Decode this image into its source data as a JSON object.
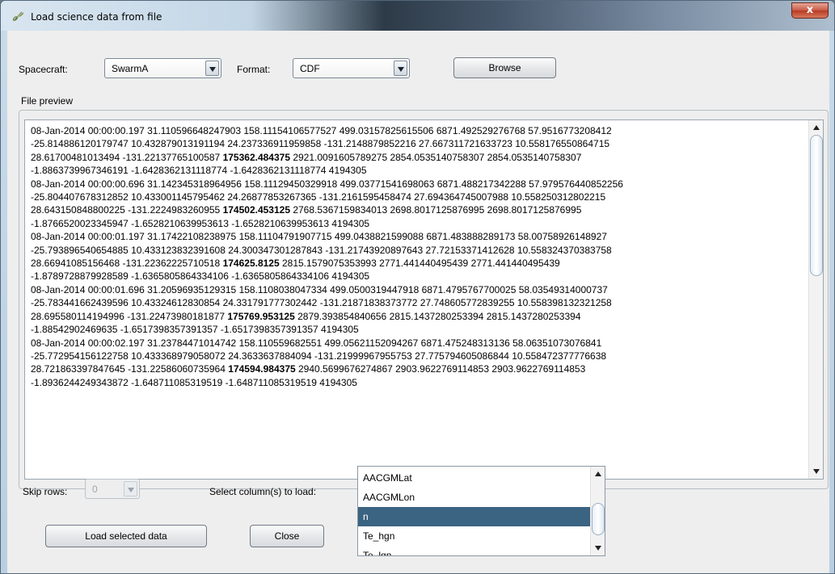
{
  "window": {
    "title": "Load science data from file",
    "close_label": "x"
  },
  "toolbar": {
    "spacecraft_label": "Spacecraft:",
    "spacecraft_value": "SwarmA",
    "format_label": "Format:",
    "format_value": "CDF",
    "browse_label": "Browse"
  },
  "preview": {
    "title": "File preview",
    "lines": [
      "08-Jan-2014 00:00:00.197 31.110596648247903 158.11154106577527 499.03157825615506 6871.492529276768 57.9516773208412",
      "-25.814886120179747 10.432879013191194 24.237336911959858 -131.2148879852216 27.667311721633723 10.558176550864715",
      "28.61700481013494 -131.22137765100587 |175362.484375| 2921.0091605789275 2854.0535140758307 2854.0535140758307",
      "-1.8863739967346191 -1.6428362131118774 -1.6428362131118774 4194305",
      "08-Jan-2014 00:00:00.696 31.142345318964956 158.11129450329918 499.03771541698063 6871.488217342288 57.979576440852256",
      "-25.804407678312852 10.433001145795462 24.26877853267365 -131.2161595458474 27.694364745007988 10.558250312802215",
      "28.643150848800225 -131.2224983260955 |174502.453125| 2768.5367159834013 2698.8017125876995 2698.8017125876995",
      "-1.8766520023345947 -1.6528210639953613 -1.6528210639953613 4194305",
      "08-Jan-2014 00:00:01.197 31.17422108238975 158.11104791907715 499.0438821599088 6871.483888289173 58.00758926148927",
      "-25.793896540654885 10.433123832391608 24.300347301287843 -131.21743920897643 27.72153371412628 10.558324370383758",
      "28.66941085156468 -131.22362225710518 |174625.8125| 2815.1579075353993 2771.441440495439 2771.441440495439",
      "-1.8789728879928589 -1.6365805864334106 -1.6365805864334106 4194305",
      "08-Jan-2014 00:00:01.696 31.20596935129315 158.1108038047334 499.0500319447918 6871.4795767700025 58.03549314000737",
      "-25.783441662439596 10.43324612830854 24.331791777302442 -131.21871838373772 27.748605772839255 10.558398132321258",
      "28.695580114194996 -131.22473980181877 |175769.953125| 2879.393854840656 2815.1437280253394 2815.1437280253394",
      "-1.88542902469635 -1.6517398357391357 -1.6517398357391357 4194305",
      "08-Jan-2014 00:00:02.197 31.23784471014742 158.110559682551 499.05621152094267 6871.475248313136 58.06351073076841",
      "-25.772954156122758 10.433368979058072 24.3633637884094 -131.21999967955753 27.775794605086844 10.558472377776638",
      "28.721863397847645 -131.22586060735964 |174594.984375| 2940.5699676274867 2903.9622769114853 2903.9622769114853",
      "-1.8936244249343872 -1.648711085319519 -1.648711085319519 4194305"
    ]
  },
  "bottom": {
    "skip_rows_label": "Skip rows:",
    "skip_rows_value": "0",
    "select_columns_label": "Select column(s) to load:",
    "columns": [
      "AACGMLat",
      "AACGMLon",
      "n",
      "Te_hgn",
      "Te_lgn"
    ],
    "selected_column": "n",
    "load_button": "Load selected data",
    "close_button": "Close"
  },
  "colors": {
    "selection": "#3b6382",
    "dialog_bg": "#eeeeee"
  }
}
